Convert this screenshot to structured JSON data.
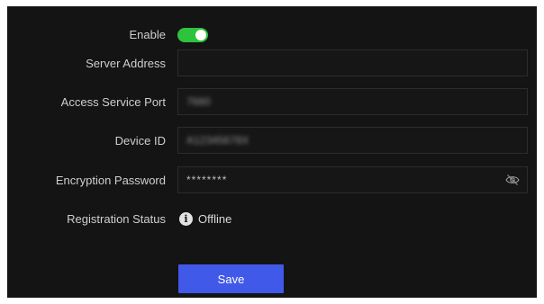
{
  "form": {
    "enable": {
      "label": "Enable",
      "state": "on",
      "color": "#2fc33b"
    },
    "server_address": {
      "label": "Server Address",
      "value": ""
    },
    "access_service_port": {
      "label": "Access Service Port",
      "value": "7660"
    },
    "device_id": {
      "label": "Device ID",
      "value": "A12345678X"
    },
    "encryption_password": {
      "label": "Encryption Password",
      "value": "********",
      "icon": "eye-slash-icon"
    },
    "registration_status": {
      "label": "Registration Status",
      "value": "Offline",
      "icon": "info-icon"
    }
  },
  "actions": {
    "save_label": "Save",
    "save_color": "#4059e8"
  }
}
